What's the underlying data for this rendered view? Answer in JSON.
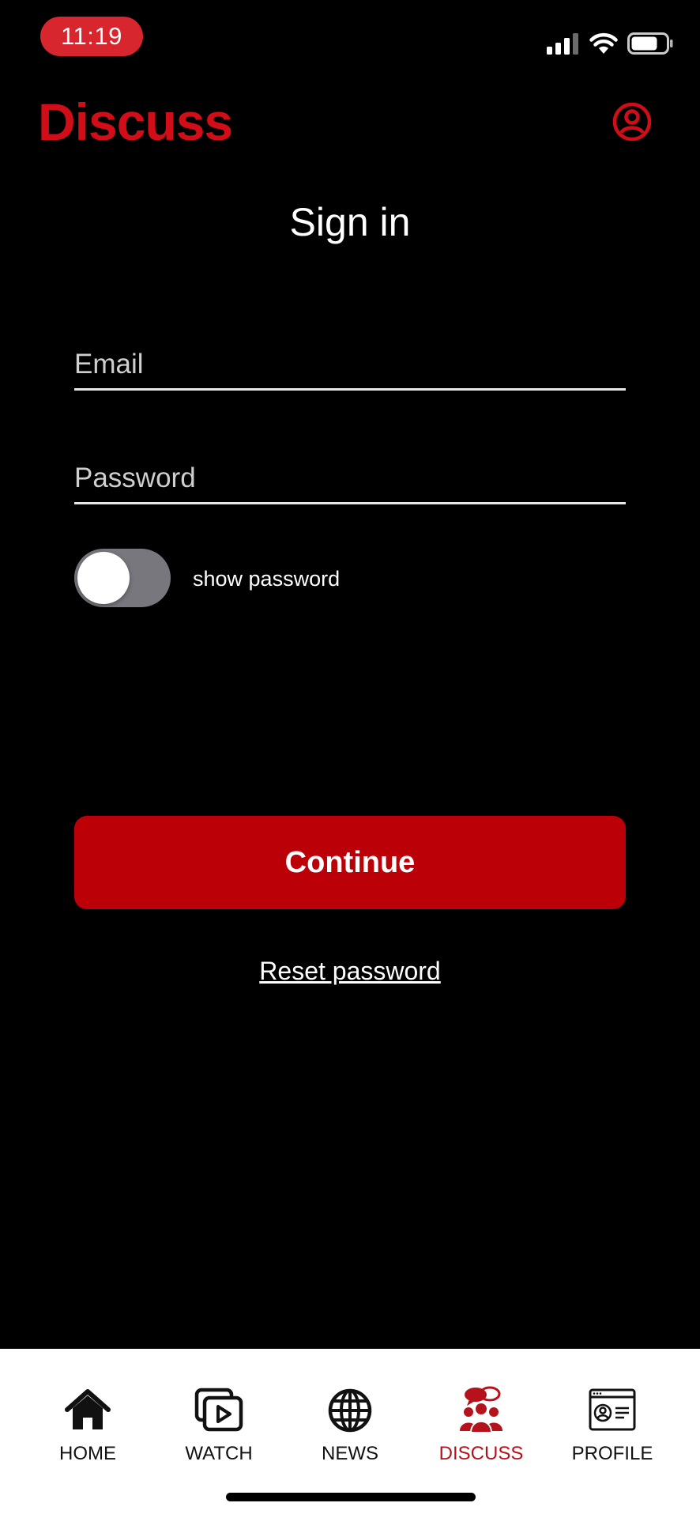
{
  "status_bar": {
    "time": "11:19",
    "icons": [
      "cellular-signal-icon",
      "wifi-icon",
      "battery-icon"
    ]
  },
  "header": {
    "app_title": "Discuss",
    "account_icon": "account-circle-icon"
  },
  "page": {
    "title": "Sign in"
  },
  "form": {
    "email_placeholder": "Email",
    "email_value": "",
    "password_placeholder": "Password",
    "password_value": "",
    "show_password_label": "show password",
    "show_password_on": false,
    "continue_label": "Continue",
    "reset_label": "Reset password"
  },
  "nav": {
    "items": [
      {
        "label": "HOME",
        "icon": "home-icon",
        "active": false
      },
      {
        "label": "WATCH",
        "icon": "video-play-icon",
        "active": false
      },
      {
        "label": "NEWS",
        "icon": "globe-icon",
        "active": false
      },
      {
        "label": "DISCUSS",
        "icon": "discussion-group-icon",
        "active": true
      },
      {
        "label": "PROFILE",
        "icon": "profile-card-icon",
        "active": false
      }
    ]
  },
  "colors": {
    "brand_red": "#d10e17",
    "button_red": "#bc0007",
    "background": "#000000",
    "nav_background": "#ffffff"
  }
}
